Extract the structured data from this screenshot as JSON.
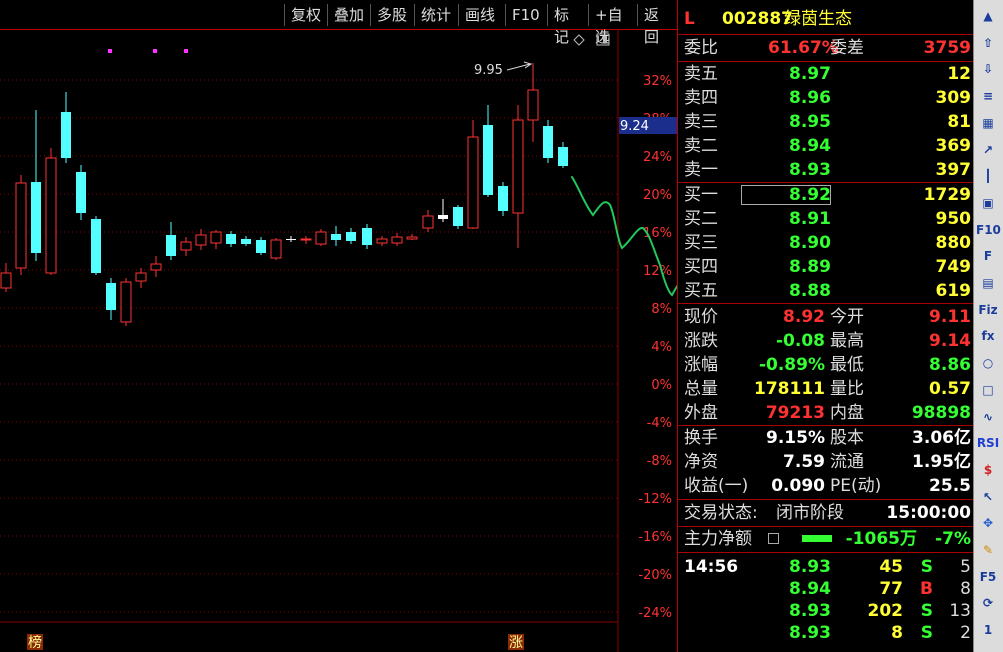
{
  "toolbar": {
    "items": [
      "复权",
      "叠加",
      "多股",
      "统计",
      "画线",
      "F10",
      "标记",
      "+自选",
      "返回"
    ]
  },
  "chart": {
    "price_marker": "9.24",
    "high_label": "9.95",
    "bottom_markers": {
      "left": "榜",
      "right": "涨"
    },
    "y_axis_ticks": [
      "32%",
      "28%",
      "24%",
      "20%",
      "16%",
      "12%",
      "8%",
      "4%",
      "0%",
      "-4%",
      "-8%",
      "-12%",
      "-16%",
      "-20%",
      "-24%"
    ],
    "colors": {
      "up": "#ff3232",
      "down": "#54ffff",
      "flat": "#ffffff",
      "grid": "#8a0000",
      "drawn_line": "#1fc95b",
      "axis_up": "#ff3232",
      "axis_down": "#ff3232"
    }
  },
  "quote": {
    "header": {
      "market_mark": "L",
      "code": "002887",
      "name": "绿茵生态"
    },
    "weibi": {
      "label": "委比",
      "value": "61.67%",
      "diff_label": "委差",
      "diff_value": "3759"
    },
    "asks": [
      {
        "label": "卖五",
        "price": "8.97",
        "vol": "12"
      },
      {
        "label": "卖四",
        "price": "8.96",
        "vol": "309"
      },
      {
        "label": "卖三",
        "price": "8.95",
        "vol": "81"
      },
      {
        "label": "卖二",
        "price": "8.94",
        "vol": "369"
      },
      {
        "label": "卖一",
        "price": "8.93",
        "vol": "397"
      }
    ],
    "bids": [
      {
        "label": "买一",
        "price": "8.92",
        "vol": "1729"
      },
      {
        "label": "买二",
        "price": "8.91",
        "vol": "950"
      },
      {
        "label": "买三",
        "price": "8.90",
        "vol": "880"
      },
      {
        "label": "买四",
        "price": "8.89",
        "vol": "749"
      },
      {
        "label": "买五",
        "price": "8.88",
        "vol": "619"
      }
    ],
    "stats": [
      {
        "l1": "现价",
        "v1": "8.92",
        "l2": "今开",
        "v2": "9.11",
        "c1": "#ff3232",
        "c2": "#ff3232"
      },
      {
        "l1": "涨跌",
        "v1": "-0.08",
        "l2": "最高",
        "v2": "9.14",
        "c1": "#33ff33",
        "c2": "#ff3232"
      },
      {
        "l1": "涨幅",
        "v1": "-0.89%",
        "l2": "最低",
        "v2": "8.86",
        "c1": "#33ff33",
        "c2": "#33ff33"
      },
      {
        "l1": "总量",
        "v1": "178111",
        "l2": "量比",
        "v2": "0.57",
        "c1": "#ffff33",
        "c2": "#ffff33"
      },
      {
        "l1": "外盘",
        "v1": "79213",
        "l2": "内盘",
        "v2": "98898",
        "c1": "#ff3232",
        "c2": "#33ff33"
      }
    ],
    "stats2": [
      {
        "l1": "换手",
        "v1": "9.15%",
        "l2": "股本",
        "v2": "3.06亿"
      },
      {
        "l1": "净资",
        "v1": "7.59",
        "l2": "流通",
        "v2": "1.95亿"
      },
      {
        "l1": "收益(一)",
        "v1": "0.090",
        "l2": "PE(动)",
        "v2": "25.5"
      }
    ],
    "trade_status": {
      "label": "交易状态:",
      "value": "闭市阶段",
      "time": "15:00:00"
    },
    "main_flow": {
      "label": "主力净额",
      "value": "-1065万",
      "pct": "-7%"
    },
    "ticks": [
      {
        "time": "14:56",
        "price": "8.93",
        "vol": "45",
        "side": "S",
        "num": "5"
      },
      {
        "time": "",
        "price": "8.94",
        "vol": "77",
        "side": "B",
        "num": "8"
      },
      {
        "time": "",
        "price": "8.93",
        "vol": "202",
        "side": "S",
        "num": "13"
      },
      {
        "time": "",
        "price": "8.93",
        "vol": "8",
        "side": "S",
        "num": "2"
      }
    ]
  },
  "sidebar": {
    "icons": [
      "up-arrow-icon",
      "up-hollow-arrow-icon",
      "down-hollow-arrow-icon",
      "list-icon",
      "grid-icon",
      "line-chart-icon",
      "kline-icon",
      "window-icon",
      "f10-icon",
      "f-icon",
      "bookmark-icon",
      "fiz-icon",
      "fx-icon",
      "circle-icon",
      "blank-icon",
      "wave-icon",
      "rsi-icon",
      "dollar-icon",
      "cursor-icon",
      "move-icon",
      "pencil-icon",
      "f5-icon",
      "refresh-icon",
      "one-icon"
    ],
    "labels": {
      "rsi": "RSI",
      "f5": "F5",
      "f10": "F10",
      "fiz": "Fiz",
      "fx": "fx",
      "one": "1"
    }
  }
}
